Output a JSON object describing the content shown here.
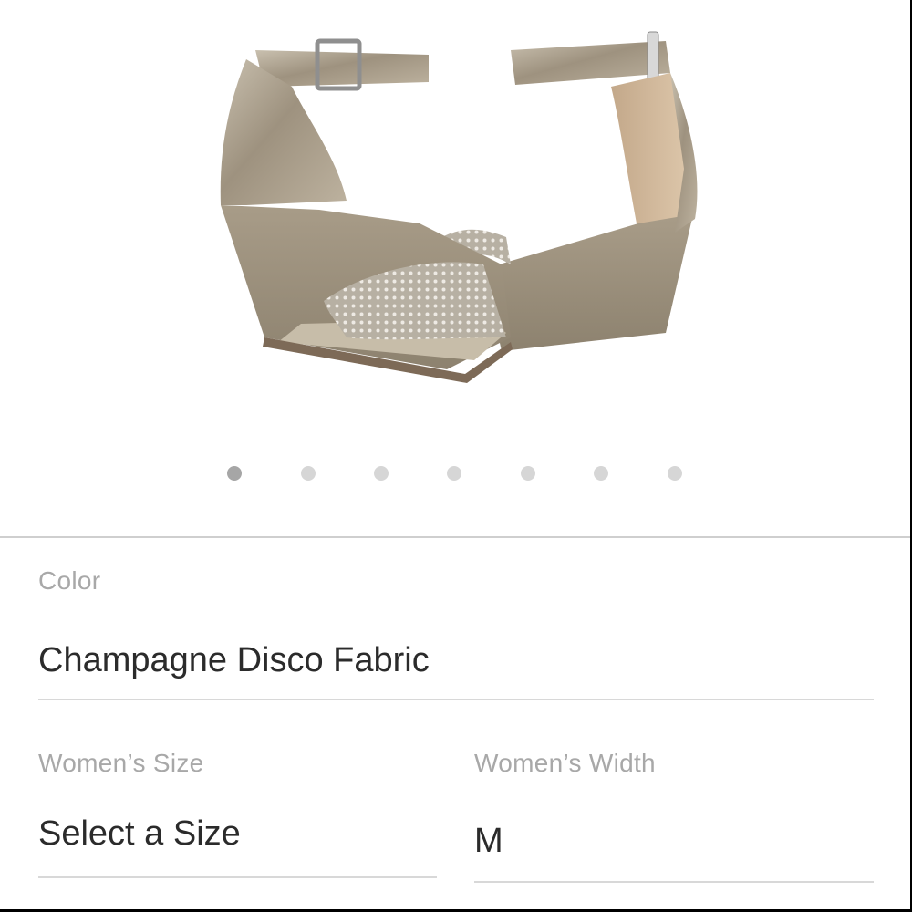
{
  "gallery": {
    "image_name": "champagne-wedge-sandals",
    "slide_count": 7,
    "active_index": 0
  },
  "color": {
    "label": "Color",
    "value": "Champagne Disco Fabric"
  },
  "size": {
    "label": "Women’s Size",
    "value": "Select a Size"
  },
  "width": {
    "label": "Women’s Width",
    "value": "M"
  },
  "colors": {
    "background": "#ffffff",
    "label_text": "#a8a8a8",
    "value_text": "#2b2b2b",
    "divider": "#cfcfcf",
    "dot_inactive": "#d6d6d6",
    "dot_active": "#a6a6a6",
    "shoe_fabric": "#b4aa98"
  }
}
